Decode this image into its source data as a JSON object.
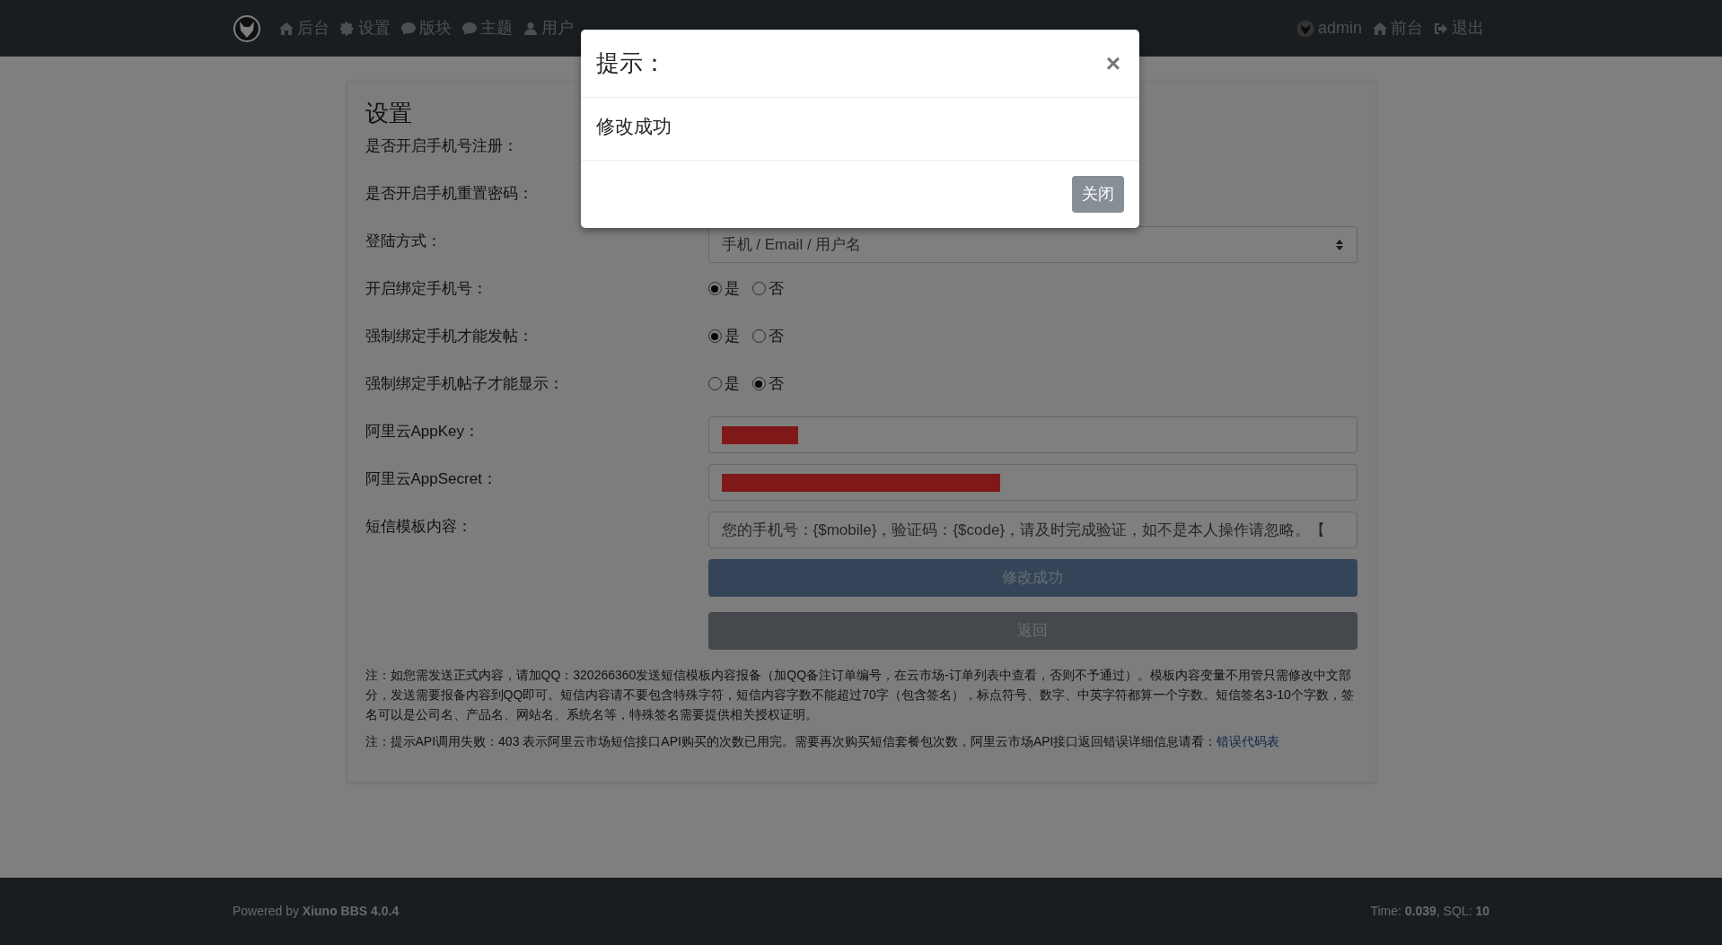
{
  "navbar": {
    "left": [
      {
        "label": "后台"
      },
      {
        "label": "设置"
      },
      {
        "label": "版块"
      },
      {
        "label": "主题"
      },
      {
        "label": "用户"
      }
    ],
    "user": "admin",
    "right": [
      {
        "label": "前台"
      },
      {
        "label": "退出"
      }
    ]
  },
  "page_title": "设置",
  "fields": [
    {
      "label": "是否开启手机号注册：",
      "kind": "blank"
    },
    {
      "label": "是否开启手机重置密码：",
      "kind": "blank"
    },
    {
      "label": "登陆方式：",
      "kind": "select",
      "value": "手机 / Email / 用户名"
    },
    {
      "label": "开启绑定手机号：",
      "kind": "radio",
      "options": [
        {
          "label": "是",
          "selected": true
        },
        {
          "label": "否",
          "selected": false
        }
      ]
    },
    {
      "label": "强制绑定手机才能发帖：",
      "kind": "radio",
      "options": [
        {
          "label": "是",
          "selected": true
        },
        {
          "label": "否",
          "selected": false
        }
      ]
    },
    {
      "label": "强制绑定手机帖子才能显示：",
      "kind": "radio",
      "options": [
        {
          "label": "是",
          "selected": false
        },
        {
          "label": "否",
          "selected": true
        }
      ]
    },
    {
      "label": "阿里云AppKey：",
      "kind": "redacted"
    },
    {
      "label": "阿里云AppSecret：",
      "kind": "redacted"
    },
    {
      "label": "短信模板内容：",
      "kind": "text",
      "value": "您的手机号：{$mobile}，验证码：{$code}，请及时完成验证，如不是本人操作请忽略。【"
    }
  ],
  "buttons": [
    {
      "label": "修改成功",
      "kind": "primary"
    },
    {
      "label": "返回",
      "kind": "secondary"
    }
  ],
  "notes": [
    {
      "text": "注：如您需发送正式内容，请加QQ：320266360发送短信模板内容报备（加QQ备注订单编号，在云市场-订单列表中查看，否则不予通过）。模板内容变量不用管只需修改中文部分，发送需要报备内容到QQ即可。短信内容请不要包含特殊字符，短信内容字数不能超过70字（包含签名），标点符号、数字、中英字符都算一个字数。短信签名3-10个字数，签名可以是公司名、产品名、网站名、系统名等，特殊签名需要提供相关授权证明。"
    },
    {
      "text": "注：提示API调用失败：403 表示阿里云市场短信接口API购买的次数已用完。需要再次购买短信套餐包次数，阿里云市场API接口返回错误详细信息请看：",
      "link": "错误代码表"
    }
  ],
  "footer": {
    "left": "Powered by **Xiuno BBS 4.0.4**",
    "right": "Time: **0.039**, SQL: **10**"
  },
  "modal": {
    "title": "提示：",
    "close": "×",
    "body": "修改成功",
    "button": "关闭"
  }
}
